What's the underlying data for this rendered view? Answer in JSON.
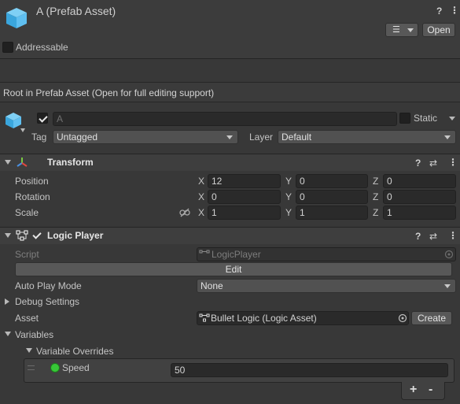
{
  "header": {
    "title": "A (Prefab Asset)",
    "open_label": "Open",
    "addressable_label": "Addressable",
    "addressable_checked": false
  },
  "prefab_note": "Root in Prefab Asset (Open for full editing support)",
  "object": {
    "name_placeholder": "A",
    "active": true,
    "static_label": "Static",
    "tag_label": "Tag",
    "tag_value": "Untagged",
    "layer_label": "Layer",
    "layer_value": "Default"
  },
  "transform": {
    "title": "Transform",
    "rows": [
      {
        "label": "Position",
        "x": "12",
        "y": "0",
        "z": "0"
      },
      {
        "label": "Rotation",
        "x": "0",
        "y": "0",
        "z": "0"
      },
      {
        "label": "Scale",
        "x": "1",
        "y": "1",
        "z": "1"
      }
    ],
    "axis_x": "X",
    "axis_y": "Y",
    "axis_z": "Z"
  },
  "logic_player": {
    "title": "Logic Player",
    "enabled": true,
    "script_label": "Script",
    "script_value": "LogicPlayer",
    "edit_label": "Edit",
    "auto_play_label": "Auto Play Mode",
    "auto_play_value": "None",
    "debug_label": "Debug Settings",
    "asset_label": "Asset",
    "asset_value": "Bullet Logic (Logic Asset)",
    "create_label": "Create",
    "variables_label": "Variables",
    "overrides_label": "Variable Overrides",
    "speed_label": "Speed",
    "speed_value": "50",
    "add_label": "+",
    "remove_label": "-"
  },
  "colors": {
    "background": "#383838",
    "cube_icon": "#4fb4e8",
    "speed_dot": "#37c837"
  }
}
